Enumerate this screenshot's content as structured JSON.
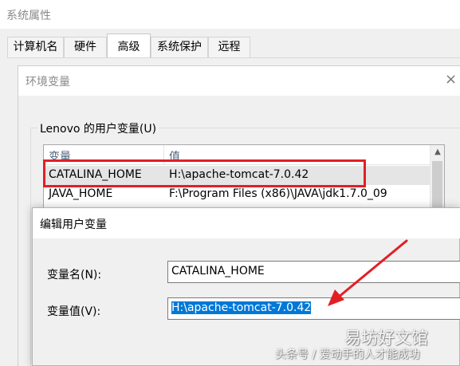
{
  "system_properties": {
    "title": "系统属性",
    "tabs": [
      {
        "label": "计算机名"
      },
      {
        "label": "硬件"
      },
      {
        "label": "高级"
      },
      {
        "label": "系统保护"
      },
      {
        "label": "远程"
      }
    ],
    "active_tab": "高级"
  },
  "env_window": {
    "title": "环境变量",
    "close_glyph": "×",
    "user_group_label": "Lenovo 的用户变量(U)",
    "list": {
      "columns": [
        "变量",
        "值"
      ],
      "rows": [
        {
          "name": "CATALINA_HOME",
          "value": "H:\\apache-tomcat-7.0.42"
        },
        {
          "name": "JAVA_HOME",
          "value": "F:\\Program Files (x86)\\JAVA\\jdk1.7.0_09"
        }
      ],
      "selected_row": 0,
      "scroll_up_glyph": "▲"
    }
  },
  "edit_dialog": {
    "title": "编辑用户变量",
    "name_label": "变量名(N):",
    "value_label": "变量值(V):",
    "name_value": "CATALINA_HOME",
    "value_value": "H:\\apache-tomcat-7.0.42"
  },
  "watermark": {
    "site": "易坊好文馆",
    "author": "头条号 / 爱动手的人才能成功"
  },
  "colors": {
    "highlight": "#e21f25",
    "selection": "#0078d7"
  }
}
